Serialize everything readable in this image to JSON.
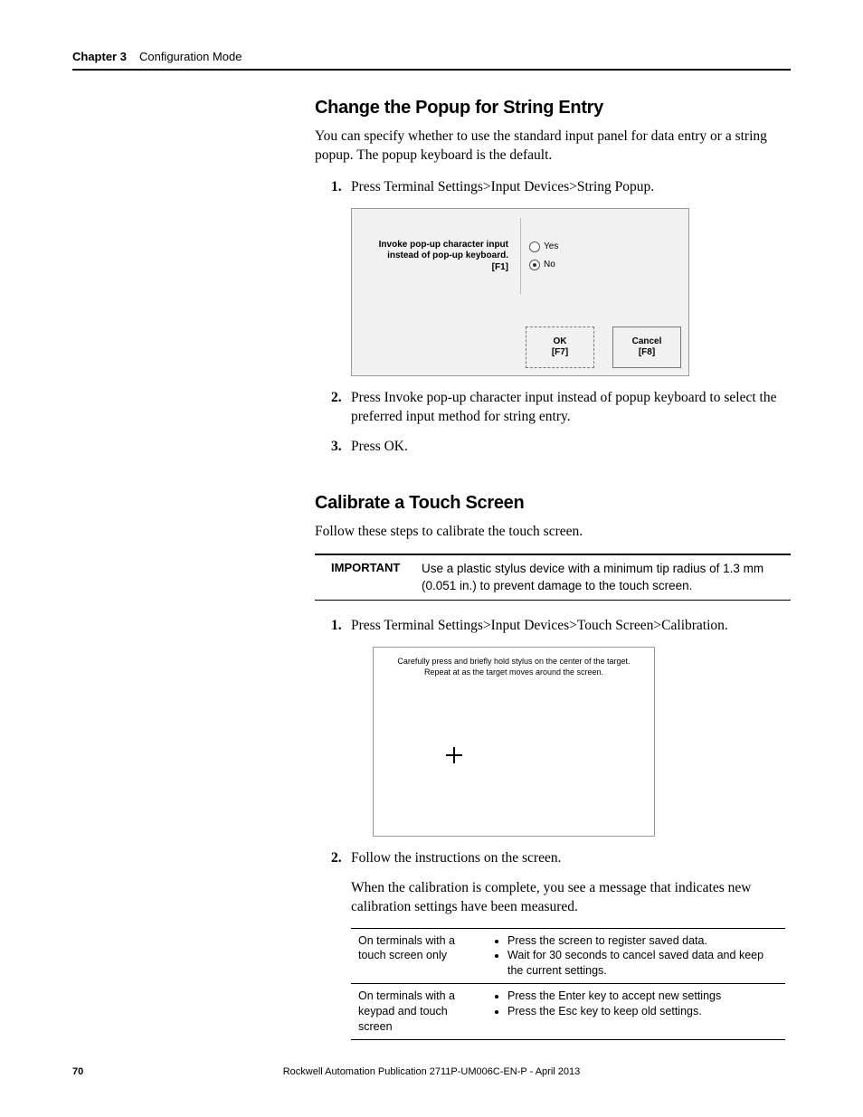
{
  "header": {
    "chapter": "Chapter 3",
    "title": "Configuration Mode"
  },
  "section1": {
    "heading": "Change the Popup for String Entry",
    "intro": "You can specify whether to use the standard input panel for data entry or a string popup. The popup keyboard is the default.",
    "steps": {
      "s1": {
        "num": "1.",
        "text": "Press Terminal Settings>Input Devices>String Popup."
      },
      "s2": {
        "num": "2.",
        "text": "Press Invoke pop-up character input instead of popup keyboard to select the preferred input method for string entry."
      },
      "s3": {
        "num": "3.",
        "text": "Press OK."
      }
    },
    "screenshot": {
      "label_line1": "Invoke pop-up character input",
      "label_line2": "instead of pop-up keyboard.",
      "label_line3": "[F1]",
      "radio_yes": "Yes",
      "radio_no": "No",
      "ok_line1": "OK",
      "ok_line2": "[F7]",
      "cancel_line1": "Cancel",
      "cancel_line2": "[F8]"
    }
  },
  "section2": {
    "heading": "Calibrate a Touch Screen",
    "intro": "Follow these steps to calibrate the touch screen.",
    "important": {
      "label": "IMPORTANT",
      "text": "Use a plastic stylus device with a minimum tip radius of 1.3 mm (0.051 in.) to prevent damage to the touch screen."
    },
    "steps": {
      "s1": {
        "num": "1.",
        "text": "Press Terminal Settings>Input Devices>Touch Screen>Calibration."
      },
      "s2": {
        "num": "2.",
        "text": "Follow the instructions on the screen."
      }
    },
    "screenshot": {
      "line1": "Carefully press and briefly hold stylus on the center of the target.",
      "line2": "Repeat at as the target moves around the screen."
    },
    "after": "When the calibration is complete, you see a message that indicates new calibration settings have been measured.",
    "table": {
      "r1c1": "On terminals with a touch screen only",
      "r1c2a": "Press the screen to register saved data.",
      "r1c2b": "Wait for 30 seconds to cancel saved data and keep the current settings.",
      "r2c1": "On terminals with a keypad and touch screen",
      "r2c2a": "Press the Enter key to accept new settings",
      "r2c2b": "Press the Esc key to keep old settings."
    }
  },
  "footer": {
    "page": "70",
    "pub": "Rockwell Automation Publication 2711P-UM006C-EN-P - April 2013"
  }
}
